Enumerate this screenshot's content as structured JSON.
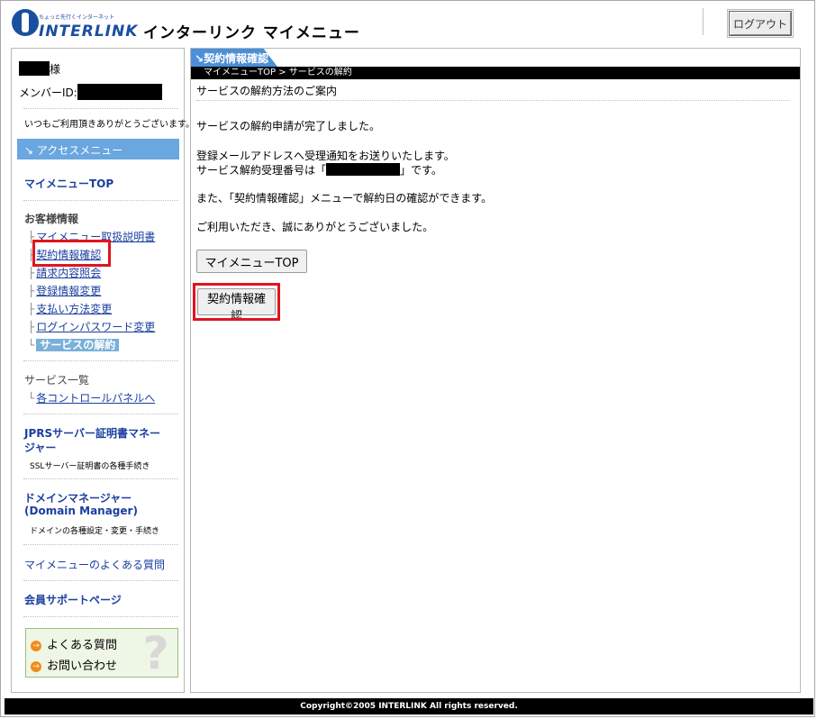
{
  "header": {
    "logo_tagline": "ちょっと先行くインターネット",
    "logo_brand": "INTERLINK",
    "app_title": "インターリンク マイメニュー",
    "logout_label": "ログアウト"
  },
  "sidebar": {
    "user_suffix": "様",
    "member_id_label": "メンバーID:",
    "greeting": "いつもご利用頂きありがとうございます。",
    "access_menu": "アクセスメニュー",
    "mymenu_top": "マイメニューTOP",
    "customer_info_heading": "お客様情報",
    "customer_items": [
      "マイメニュー取扱説明書",
      "契約情報確認",
      "請求内容照会",
      "登録情報変更",
      "支払い方法変更",
      "ログインパスワード変更",
      "サービスの解約"
    ],
    "service_list_heading": "サービス一覧",
    "service_list_item": "各コントロールパネルへ",
    "jprs_link": "JPRSサーバー証明書マネー",
    "jprs_link_line2": "ジャー",
    "jprs_desc": "SSLサーバー証明書の各種手続き",
    "domain_link": "ドメインマネージャー",
    "domain_link_line2": "(Domain Manager)",
    "domain_desc": "ドメインの各種設定・変更・手続き",
    "faq_link": "マイメニューのよくある質問",
    "support_link": "会員サポートページ",
    "help_faq": "よくある質問",
    "help_contact": "お問い合わせ"
  },
  "main": {
    "section_tab": "契約情報確認",
    "breadcrumb": "マイメニューTOP > サービスの解約",
    "page_title": "サービスの解約方法のご案内",
    "msg_complete": "サービスの解約申請が完了しました。",
    "msg_notice": "登録メールアドレスへ受理通知をお送りいたします。",
    "msg_number_prefix": "サービス解約受理番号は「",
    "msg_number_suffix": "」です。",
    "msg_confirm": "また、「契約情報確認」メニューで解約日の確認ができます。",
    "msg_thanks": "ご利用いただき、誠にありがとうございました。",
    "btn_mymenu_top": "マイメニューTOP",
    "btn_contract": "契約情報確認"
  },
  "footer": {
    "copyright": "Copyright©2005 INTERLINK All rights reserved."
  },
  "colors": {
    "brand_blue": "#1a4fa0",
    "link_blue": "#1a3fa0",
    "accent_blue": "#4a8fd8",
    "highlight_red": "#e0141e"
  }
}
